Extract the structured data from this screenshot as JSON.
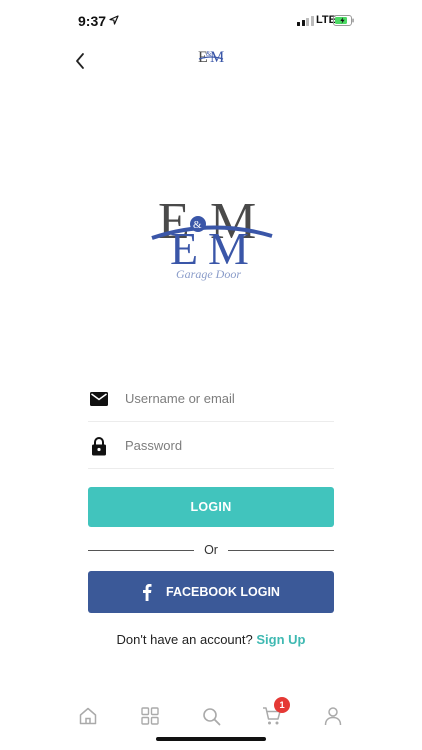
{
  "status_bar": {
    "time": "9:37",
    "network": "LTE",
    "battery_color": "#4cd964"
  },
  "nav": {
    "back_icon": "chevron-left-icon",
    "header_logo_text": "E&M"
  },
  "logo": {
    "letters": "E&M",
    "tagline": "Garage Door",
    "primary_color": "#4a4a4a",
    "accent_color": "#3a56a8"
  },
  "form": {
    "username": {
      "icon": "mail-icon",
      "placeholder": "Username or email",
      "value": ""
    },
    "password": {
      "icon": "lock-icon",
      "placeholder": "Password",
      "value": ""
    },
    "login_label": "LOGIN",
    "login_color": "#41c4bd",
    "or_text": "Or",
    "facebook_label": "FACEBOOK LOGIN",
    "facebook_color": "#3b5998",
    "signup_prompt": "Don't have an account?",
    "signup_link": "Sign Up"
  },
  "tabbar": {
    "items": [
      {
        "icon": "home-icon"
      },
      {
        "icon": "grid-icon"
      },
      {
        "icon": "search-icon"
      },
      {
        "icon": "cart-icon"
      },
      {
        "icon": "profile-icon"
      }
    ],
    "cart_badge": "1"
  }
}
